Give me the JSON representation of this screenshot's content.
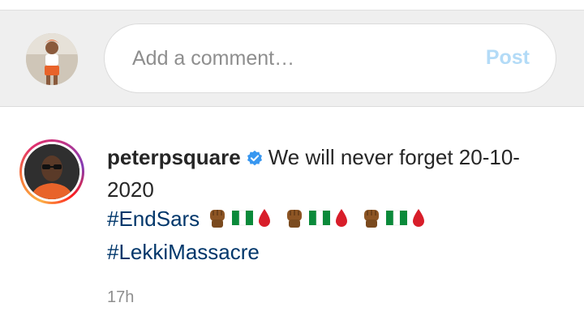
{
  "comment_bar": {
    "placeholder": "Add a comment…",
    "post_label": "Post",
    "avatar_icon": "user-avatar-photo"
  },
  "post": {
    "username": "peterpsquare",
    "verified_icon": "verified-badge-icon",
    "caption_text": "We will never forget 20-10-2020",
    "hashtag_1": "#EndSars",
    "hashtag_2": "#LekkiMassacre",
    "emoji_sequence": [
      "raised-fist-dark-skin",
      "nigeria-flag",
      "drop-of-blood",
      "raised-fist-dark-skin",
      "nigeria-flag",
      "drop-of-blood",
      "raised-fist-dark-skin",
      "nigeria-flag",
      "drop-of-blood"
    ],
    "timestamp": "17h"
  },
  "colors": {
    "post_button": "#b3dbf7",
    "hashtag": "#00376b",
    "verified": "#3897f0",
    "secondary_text": "#8e8e8e"
  }
}
